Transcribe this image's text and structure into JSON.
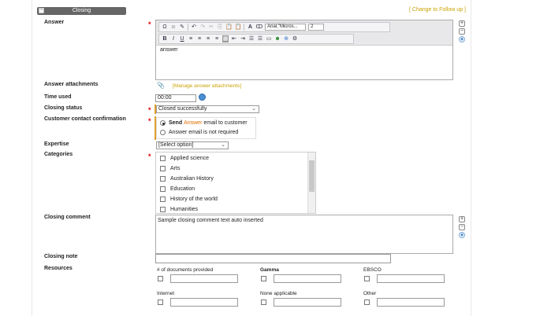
{
  "section": {
    "title": "Closing",
    "collapse_glyph": "−",
    "change_link": "[ Change to Follow up ]"
  },
  "labels": {
    "answer": "Answer",
    "answer_attachments": "Answer attachments",
    "time_used": "Time used",
    "closing_status": "Closing status",
    "customer_contact": "Customer contact confirmation",
    "expertise": "Expertise",
    "categories": "Categories",
    "closing_comment": "Closing comment",
    "closing_note": "Closing note",
    "resources": "Resources",
    "required_mark": "*"
  },
  "editor": {
    "font_select": "Arial,\"Micros...",
    "size_select": "2",
    "content": "answer",
    "toolbar_row1": [
      "Ω",
      "☺",
      "✎",
      "↶",
      "↷",
      "✂",
      "⎘",
      "📋",
      "📋",
      "A",
      "ↀ"
    ],
    "toolbar_row2": [
      "B",
      "I",
      "U",
      "≡",
      "≡",
      "≡",
      "≡",
      "▦",
      "⇤",
      "⇥",
      "☰",
      "☰",
      "▭",
      "☻",
      "⊕",
      "⚙"
    ]
  },
  "attachments": {
    "link": "[Manage answer attachments]",
    "icon": "paperclip-icon"
  },
  "time_used": {
    "value": "00:00",
    "icon": "clock-icon"
  },
  "closing_status": {
    "selected": "Closed successfully"
  },
  "contact": {
    "option1_pre": "Send ",
    "option1_link": "Answer",
    "option1_post": " email to customer",
    "option2": "Answer email is not required"
  },
  "expertise": {
    "selected": "[Select option]"
  },
  "categories": {
    "items": [
      "Applied science",
      "Arts",
      "Australian History",
      "Education",
      "History of the world",
      "Humanities"
    ]
  },
  "closing_comment": {
    "value": "Sample closing comment text auto inserted"
  },
  "closing_note": {
    "value": ""
  },
  "resources": {
    "items": [
      {
        "label": "# of documents provided",
        "bold": false
      },
      {
        "label": "Gamma",
        "bold": true
      },
      {
        "label": "EBSCO",
        "bold": false
      },
      {
        "label": "Internet",
        "bold": false
      },
      {
        "label": "None applicable",
        "bold": false
      },
      {
        "label": "Other",
        "bold": false
      }
    ]
  },
  "side_icons": {
    "plus": "+",
    "minus": "−",
    "eye": "👁"
  },
  "colors": {
    "accent_link": "#c9a200",
    "orange_link": "#e07000",
    "header_bg": "#666666",
    "required": "#dd0000"
  }
}
